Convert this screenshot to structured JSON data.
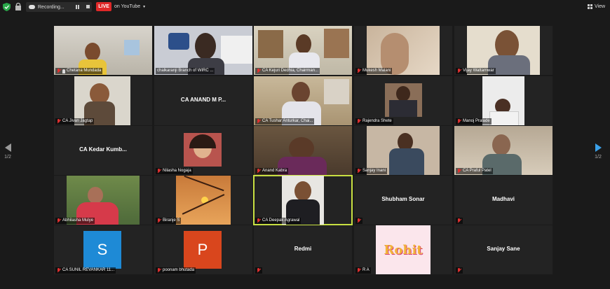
{
  "topbar": {
    "recording_label": "Recording...",
    "live_badge": "LIVE",
    "live_target": "on YouTube",
    "view_label": "View"
  },
  "pager": {
    "left": "1/2",
    "right": "1/2"
  },
  "participants": [
    {
      "name": "Chetana Mundada",
      "video": true,
      "pinned": true
    },
    {
      "name": "chalkaranji Branch of WIRC ...",
      "video": true
    },
    {
      "name": "CA Kejuri Dedhia, Chairman...",
      "video": true
    },
    {
      "name": "Mukesh Malani",
      "video": true
    },
    {
      "name": "Vijay Wattamwar",
      "video": true
    },
    {
      "name": "CA Jivan Jagtap",
      "video": true
    },
    {
      "name": "CA ANAND M P...",
      "center": "CA ANAND M P...",
      "video": false
    },
    {
      "name": "CA Tushar Anturkar, Chai...",
      "video": true
    },
    {
      "name": "Rajendra Shete",
      "video": true
    },
    {
      "name": "Manoj Pralade",
      "video": true
    },
    {
      "name": "CA Kedar Kumb...",
      "center": "CA Kedar Kumb...",
      "video": false
    },
    {
      "name": "Nilasha Nogaja",
      "video": true
    },
    {
      "name": "Anand Kabra",
      "video": true
    },
    {
      "name": "Sanjay Inani",
      "video": true
    },
    {
      "name": "CA Praful Patel",
      "video": true
    },
    {
      "name": "Abhilasha Mulye",
      "video": true
    },
    {
      "name": "Biranje S",
      "video": true
    },
    {
      "name": "CA Deepak Agrawal",
      "video": true,
      "active": true
    },
    {
      "name": "",
      "center": "Shubham Sonar",
      "video": false
    },
    {
      "name": "",
      "center": "Madhavi",
      "video": false
    },
    {
      "name": "CA SUNIL REVANKAR 11...",
      "avatar": "S",
      "avatar_color": "#1e8ad6",
      "video": false
    },
    {
      "name": "poonam bhutada",
      "avatar": "P",
      "avatar_color": "#d9461d",
      "video": false
    },
    {
      "name": "",
      "center": "Redmi",
      "video": false
    },
    {
      "name": "R A",
      "avatar_text": "Rohit",
      "video": false
    },
    {
      "name": "",
      "center": "Sanjay Sane",
      "video": false
    }
  ]
}
